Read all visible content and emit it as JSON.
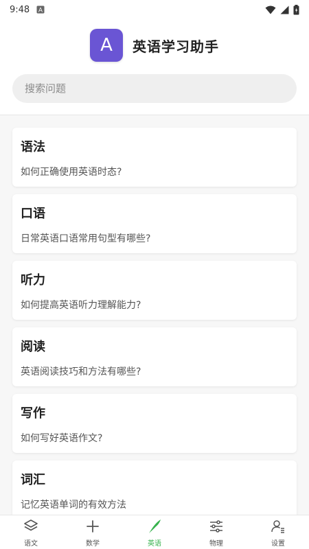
{
  "status_bar": {
    "time": "9:48",
    "notification_icon": "A",
    "icons": [
      "wifi-icon",
      "cell-signal-icon",
      "battery-icon"
    ]
  },
  "header": {
    "logo_letter": "A",
    "title": "英语学习助手",
    "brand_color": "#6a55d4"
  },
  "search": {
    "placeholder": "搜索问题",
    "value": ""
  },
  "topics": [
    {
      "title": "语法",
      "question": "如何正确使用英语时态?"
    },
    {
      "title": "口语",
      "question": "日常英语口语常用句型有哪些?"
    },
    {
      "title": "听力",
      "question": "如何提高英语听力理解能力?"
    },
    {
      "title": "阅读",
      "question": "英语阅读技巧和方法有哪些?"
    },
    {
      "title": "写作",
      "question": "如何写好英语作文?"
    },
    {
      "title": "词汇",
      "question": "记忆英语单词的有效方法"
    }
  ],
  "bottom_nav": {
    "active_color": "#37b24d",
    "items": [
      {
        "label": "语文",
        "icon": "layers-icon"
      },
      {
        "label": "数学",
        "icon": "plus-icon"
      },
      {
        "label": "英语",
        "icon": "feather-icon",
        "active": true
      },
      {
        "label": "物理",
        "icon": "sliders-icon"
      },
      {
        "label": "设置",
        "icon": "user-settings-icon"
      }
    ]
  }
}
